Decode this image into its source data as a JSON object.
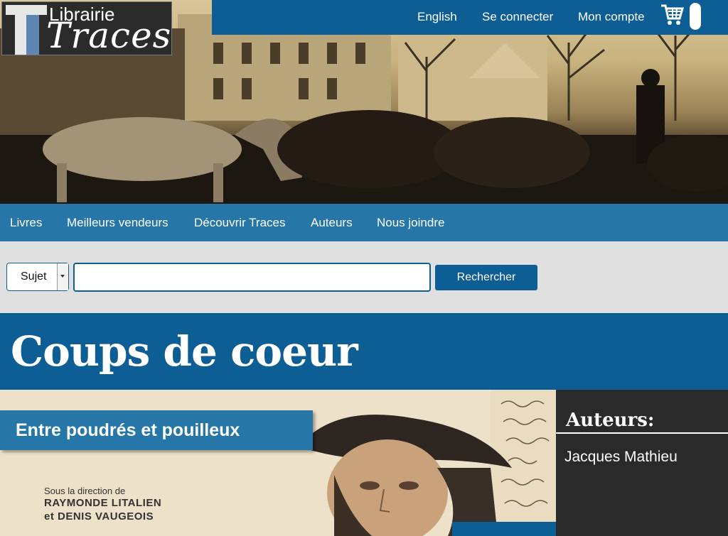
{
  "logo": {
    "top_text": "Librairie",
    "main_text": "Traces"
  },
  "top_links": {
    "language": "English",
    "login": "Se connecter",
    "account": "Mon compte"
  },
  "nav": {
    "items": [
      "Livres",
      "Meilleurs vendeurs",
      "Découvrir Traces",
      "Auteurs",
      "Nous joindre"
    ]
  },
  "search": {
    "category": "Sujet",
    "query": "",
    "button": "Rechercher"
  },
  "section": {
    "title": "Coups de coeur"
  },
  "featured": {
    "title": "Entre poudrés et pouilleux",
    "cover_line1": "Sous la direction de",
    "cover_line2": "RAYMONDE LITALIEN",
    "cover_line3": "et DENIS VAUGEOIS"
  },
  "authors": {
    "heading": "Auteurs:",
    "names": [
      "Jacques Mathieu"
    ]
  },
  "colors": {
    "primary": "#0e5e96",
    "nav": "#2776a8",
    "search_bg": "#e0e0e0",
    "sidebar": "#2a2a2a"
  },
  "icons": {
    "cart": "shopping-cart-icon",
    "dropdown": "caret-down-icon"
  }
}
